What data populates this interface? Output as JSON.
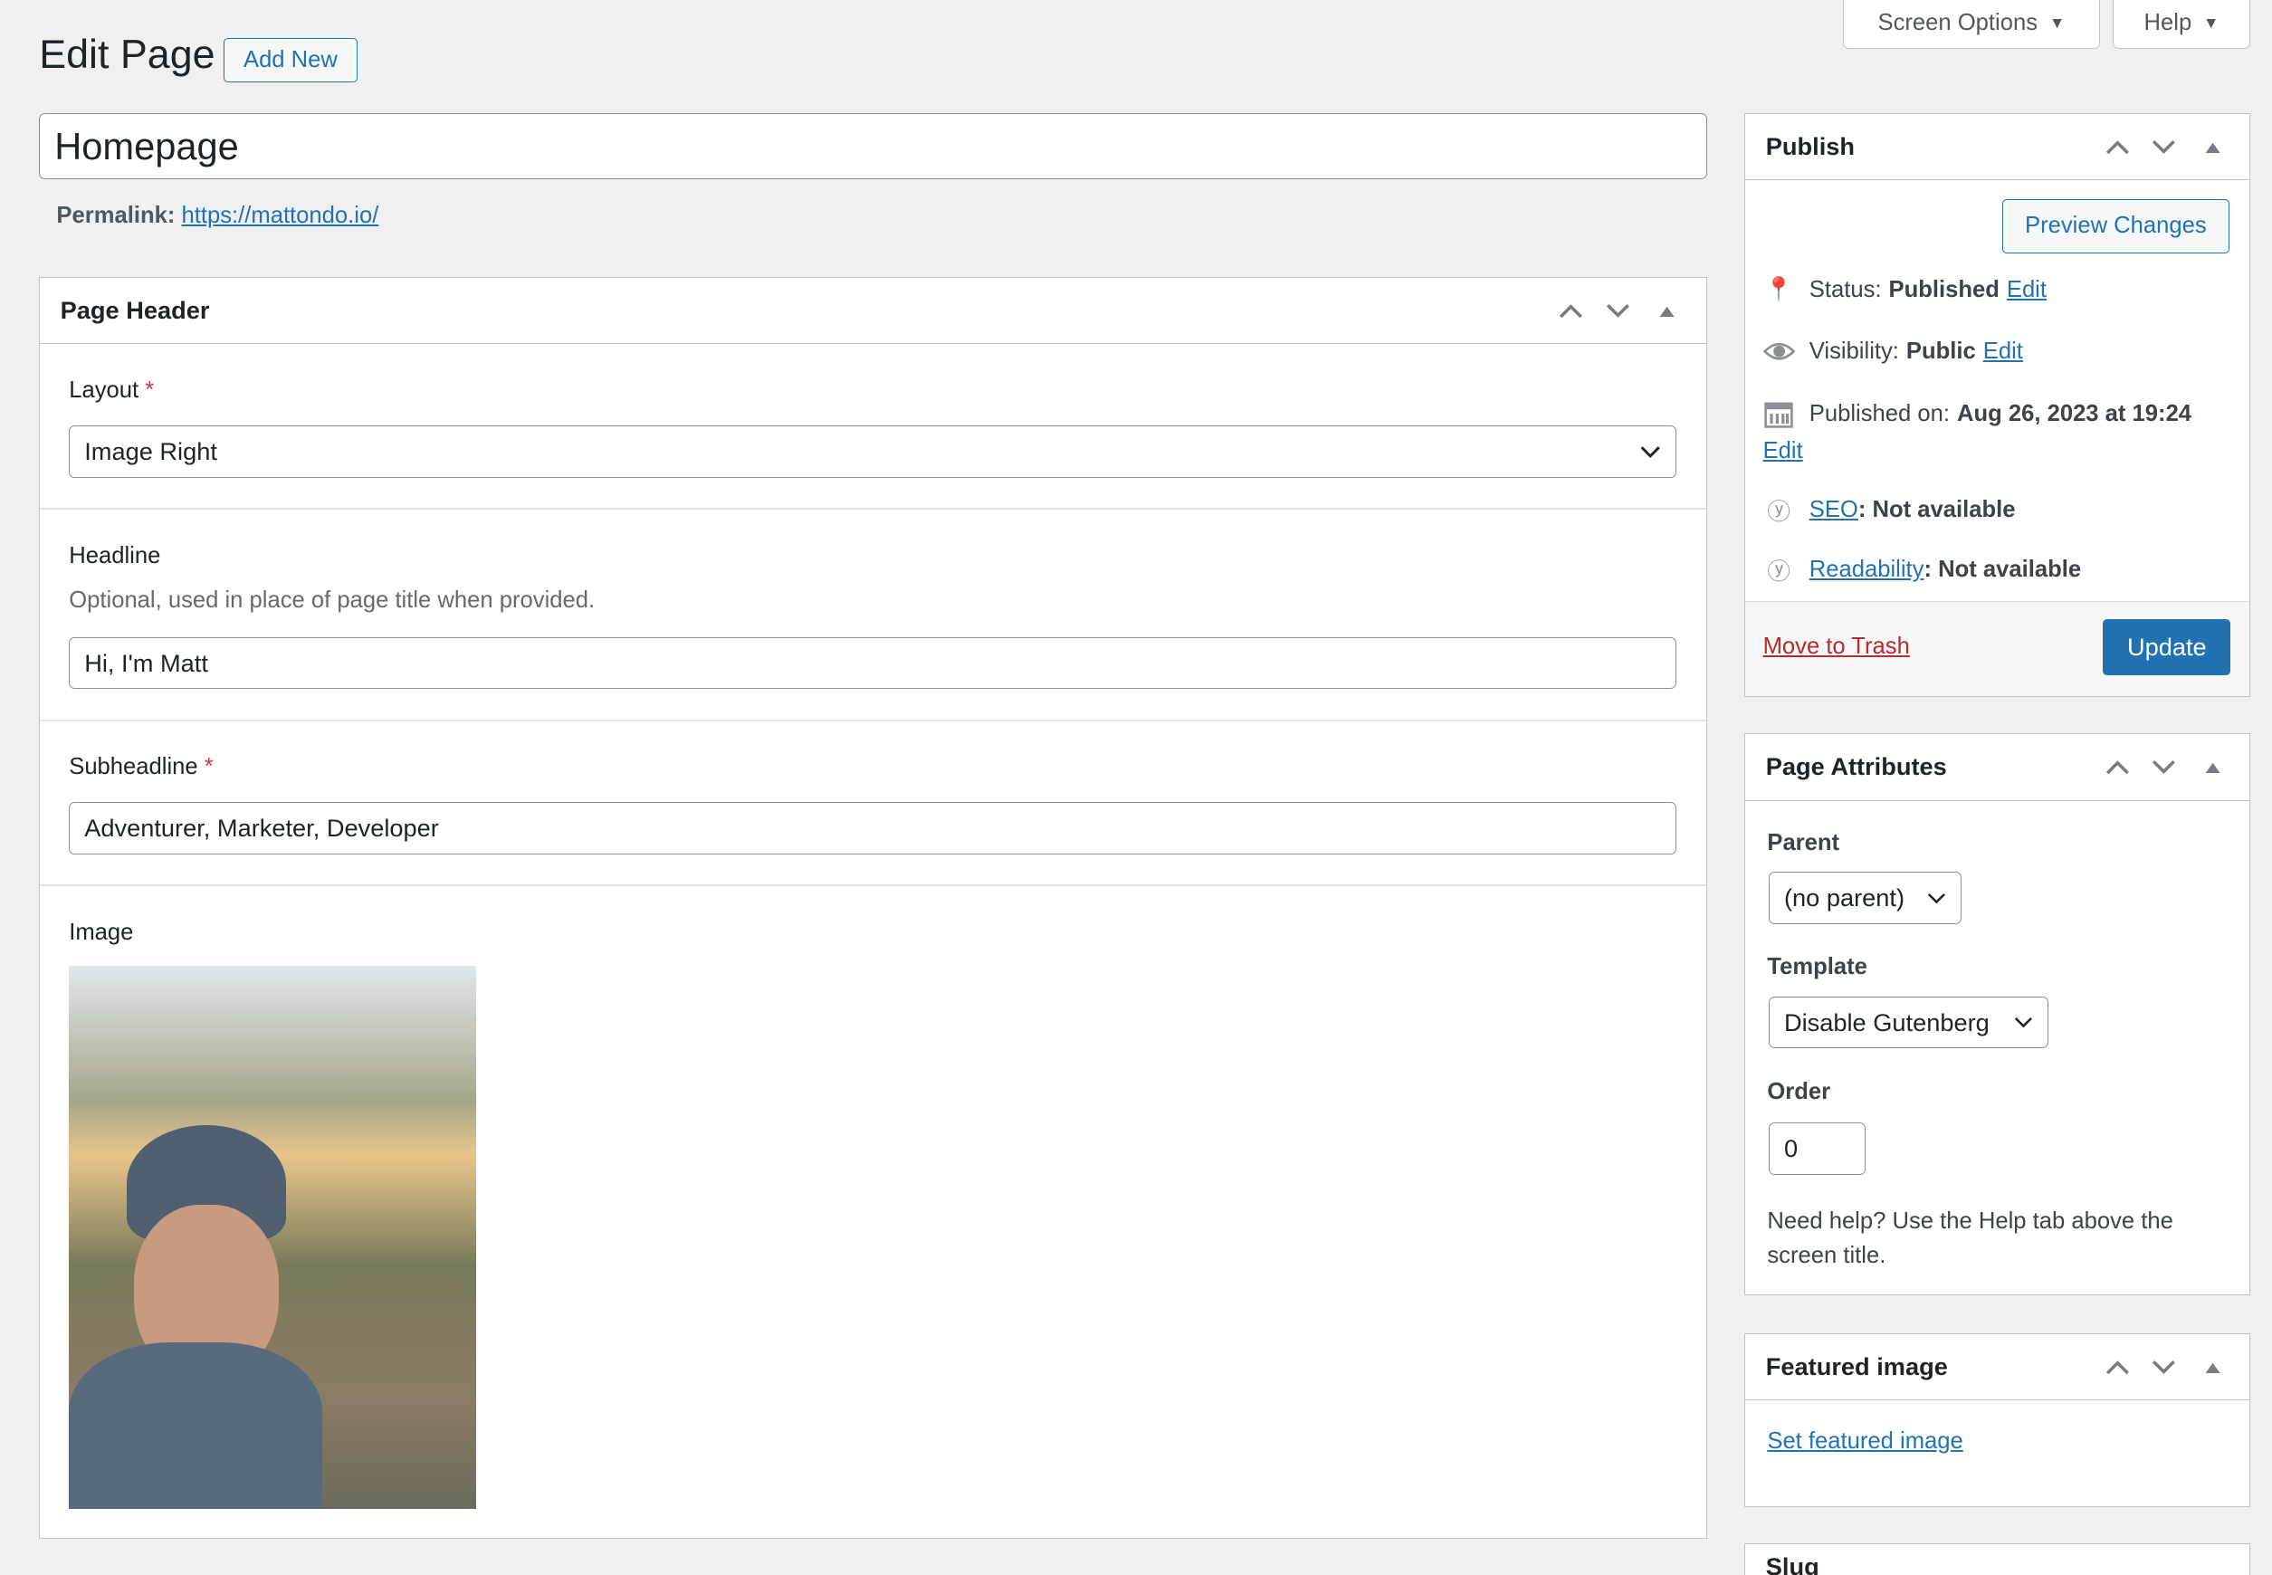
{
  "top_tabs": {
    "screen_options": "Screen Options",
    "help": "Help"
  },
  "header": {
    "title": "Edit Page",
    "add_new": "Add New"
  },
  "post_title": "Homepage",
  "permalink": {
    "label": "Permalink:",
    "url": "https://mattondo.io/"
  },
  "page_header_box": {
    "title": "Page Header",
    "layout": {
      "label": "Layout",
      "required": "*",
      "value": "Image Right"
    },
    "headline": {
      "label": "Headline",
      "description": "Optional, used in place of page title when provided.",
      "value": "Hi, I'm Matt"
    },
    "subheadline": {
      "label": "Subheadline",
      "required": "*",
      "value": "Adventurer, Marketer, Developer"
    },
    "image": {
      "label": "Image"
    }
  },
  "publish": {
    "title": "Publish",
    "preview": "Preview Changes",
    "status_label": "Status:",
    "status_value": "Published",
    "edit": "Edit",
    "visibility_label": "Visibility:",
    "visibility_value": "Public",
    "published_label": "Published on:",
    "published_value": "Aug 26, 2023 at 19:24",
    "seo_link": "SEO",
    "seo_value": ": Not available",
    "readability_link": "Readability",
    "readability_value": ": Not available",
    "trash": "Move to Trash",
    "update": "Update"
  },
  "page_attributes": {
    "title": "Page Attributes",
    "parent_label": "Parent",
    "parent_value": "(no parent)",
    "template_label": "Template",
    "template_value": "Disable Gutenberg",
    "order_label": "Order",
    "order_value": "0",
    "help": "Need help? Use the Help tab above the screen title."
  },
  "featured_image": {
    "title": "Featured image",
    "link": "Set featured image"
  },
  "slug": {
    "title": "Slug"
  },
  "colors": {
    "accent": "#2271b1",
    "primary_button": "#2271b1",
    "trash": "#b32d2e",
    "background": "#f0f0f1"
  }
}
